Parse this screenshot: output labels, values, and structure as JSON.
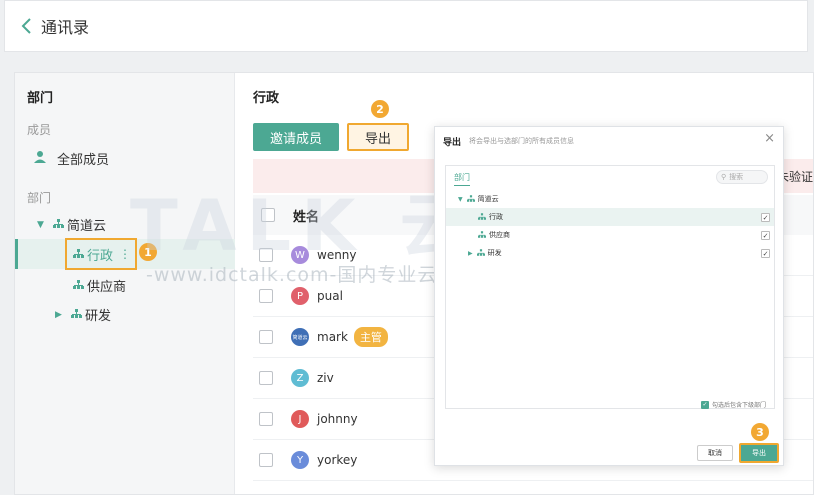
{
  "header": {
    "title": "通讯录"
  },
  "sidebar": {
    "title": "部门",
    "members_section": "成员",
    "all_members": "全部成员",
    "dept_section": "部门",
    "tree": [
      {
        "label": "简道云",
        "expanded": true
      },
      {
        "label": "行政",
        "selected": true
      },
      {
        "label": "供应商"
      },
      {
        "label": "研发",
        "collapsed": true
      }
    ]
  },
  "content": {
    "title": "行政",
    "invite_button": "邀请成员",
    "export_button": "导出",
    "alert_text": "未验证",
    "table_header": "姓名",
    "members": [
      {
        "initial": "W",
        "name": "wenny",
        "color": "#a78bdc"
      },
      {
        "initial": "P",
        "name": "pual",
        "color": "#e0606b"
      },
      {
        "initial": "简道云",
        "name": "mark",
        "color": "#3f6fb6",
        "tag": "主管"
      },
      {
        "initial": "Z",
        "name": "ziv",
        "color": "#5fbcd3"
      },
      {
        "initial": "J",
        "name": "johnny",
        "color": "#e05a5a"
      },
      {
        "initial": "Y",
        "name": "yorkey",
        "color": "#6a8cda"
      }
    ]
  },
  "modal": {
    "title": "导出",
    "subtitle": "将会导出与选部门的所有成员信息",
    "close": "×",
    "tab": "部门",
    "search_placeholder": "搜索",
    "tree": [
      {
        "label": "简道云",
        "checked": false
      },
      {
        "label": "行政",
        "checked": true
      },
      {
        "label": "供应商",
        "checked": true
      },
      {
        "label": "研发",
        "checked": true
      }
    ],
    "include_sub": "勾选后包含下级部门",
    "cancel": "取消",
    "export": "导出"
  },
  "annotations": [
    "1",
    "2",
    "3"
  ],
  "watermark": {
    "big": "TALK 云说",
    "line": "-www.idctalk.com-国内专业云计算交流服务平台-"
  },
  "colors": {
    "primary": "#4ca893",
    "highlight": "#f0a830",
    "alert_bg": "#fbecec"
  }
}
